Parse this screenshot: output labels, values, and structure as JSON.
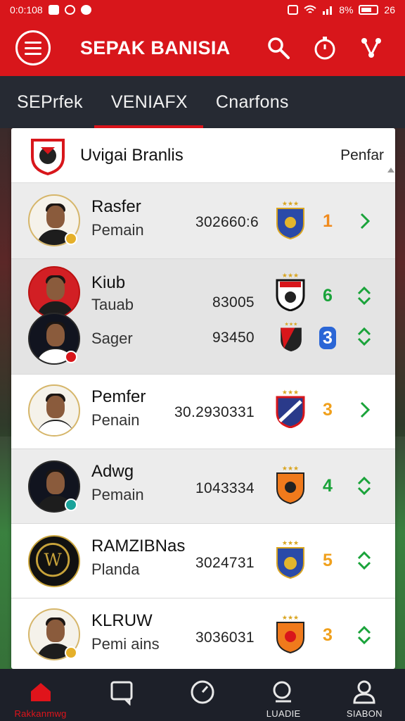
{
  "status_bar": {
    "time": "0:0:108",
    "battery_text": "8%",
    "right_text": "26"
  },
  "app_bar": {
    "title": "SEPAK BANISIA"
  },
  "tabs": [
    {
      "label": "SEPrfek",
      "active": false
    },
    {
      "label": "VENIAFX",
      "active": true
    },
    {
      "label": "Cnarfons",
      "active": false
    }
  ],
  "panel": {
    "header_title": "Uvigai Branlis",
    "header_filter": "Penfar"
  },
  "rows": [
    {
      "name": "Rasfer",
      "sub": "Pemain",
      "number": "302660:6",
      "rank": "1",
      "rank_color": "#f08a1c"
    },
    {
      "name": "Kiub",
      "sub": "Tauab",
      "number": "83005",
      "rank": "6",
      "rank_color": "#1aa33a"
    },
    {
      "name": "",
      "sub": "Sager",
      "number": "93450",
      "rank": "3",
      "rank_color": "#2a66d6"
    },
    {
      "name": "Pemfer",
      "sub": "Penain",
      "number": "30.2930331",
      "rank": "3",
      "rank_color": "#f0a01c"
    },
    {
      "name": "Adwg",
      "sub": "Pemain",
      "number": "1043334",
      "rank": "4",
      "rank_color": "#1aa33a"
    },
    {
      "name": "RAMZIBNas",
      "sub": "Planda",
      "number": "3024731",
      "rank": "5",
      "rank_color": "#f0a01c"
    },
    {
      "name": "KLRUW",
      "sub": "Pemi ains",
      "number": "3036031",
      "rank": "3",
      "rank_color": "#f0a01c"
    }
  ],
  "bottom_nav": [
    {
      "label": "Rakkanmwg",
      "icon": "home-icon",
      "active": true
    },
    {
      "label": "",
      "icon": "chat-icon",
      "active": false
    },
    {
      "label": "",
      "icon": "gauge-icon",
      "active": false
    },
    {
      "label": "LUADIE",
      "icon": "search-icon",
      "active": false
    },
    {
      "label": "SIABON",
      "icon": "profile-icon",
      "active": false
    }
  ],
  "colors": {
    "brand_red": "#d8161b",
    "tab_bar": "#262a33",
    "bottom_nav": "#1d2029"
  }
}
